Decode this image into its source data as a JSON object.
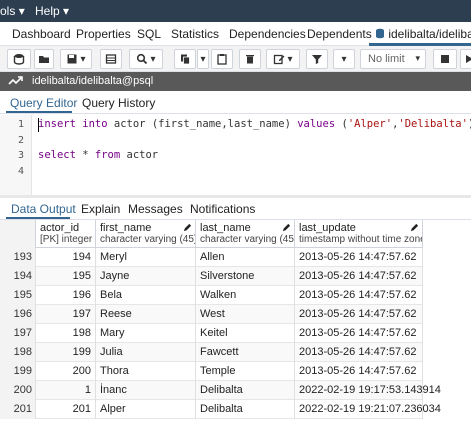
{
  "menubar": {
    "tools_label": "ols",
    "help_label": "Help"
  },
  "tabs": [
    "Dashboard",
    "Properties",
    "SQL",
    "Statistics",
    "Dependencies",
    "Dependents"
  ],
  "active_tab": {
    "label": "idelibalta/idelibalt"
  },
  "toolbar": {
    "limit_value": "No limit"
  },
  "connection": {
    "label": "idelibalta/idelibalta@psql"
  },
  "query_tabs": {
    "editor": "Query Editor",
    "history": "Query History"
  },
  "editor": {
    "line_numbers": [
      "1",
      "2",
      "3",
      "4"
    ],
    "line1": {
      "kw1": "insert",
      "kw2": "into",
      "rest1": " actor (first_name,last_name) ",
      "kw3": "values",
      "rest2": " (",
      "s1": "'Alper'",
      "comma": ",",
      "s2": "'Delibalta'",
      "rest3": ")"
    },
    "line3": {
      "kw1": "select",
      "rest1": " * ",
      "kw2": "from",
      "rest2": " actor"
    }
  },
  "result_tabs": [
    "Data Output",
    "Explain",
    "Messages",
    "Notifications"
  ],
  "columns": [
    {
      "name": "actor_id",
      "type": "[PK] integer"
    },
    {
      "name": "first_name",
      "type": "character varying (45)"
    },
    {
      "name": "last_name",
      "type": "character varying (45)"
    },
    {
      "name": "last_update",
      "type": "timestamp without time zone"
    }
  ],
  "rows": [
    {
      "n": "193",
      "id": "194",
      "first": "Meryl",
      "last": "Allen",
      "upd": "2013-05-26 14:47:57.62"
    },
    {
      "n": "194",
      "id": "195",
      "first": "Jayne",
      "last": "Silverstone",
      "upd": "2013-05-26 14:47:57.62"
    },
    {
      "n": "195",
      "id": "196",
      "first": "Bela",
      "last": "Walken",
      "upd": "2013-05-26 14:47:57.62"
    },
    {
      "n": "196",
      "id": "197",
      "first": "Reese",
      "last": "West",
      "upd": "2013-05-26 14:47:57.62"
    },
    {
      "n": "197",
      "id": "198",
      "first": "Mary",
      "last": "Keitel",
      "upd": "2013-05-26 14:47:57.62"
    },
    {
      "n": "198",
      "id": "199",
      "first": "Julia",
      "last": "Fawcett",
      "upd": "2013-05-26 14:47:57.62"
    },
    {
      "n": "199",
      "id": "200",
      "first": "Thora",
      "last": "Temple",
      "upd": "2013-05-26 14:47:57.62"
    },
    {
      "n": "200",
      "id": "1",
      "first": "İnanc",
      "last": "Delibalta",
      "upd": "2022-02-19 19:17:53.143914"
    },
    {
      "n": "201",
      "id": "201",
      "first": "Alper",
      "last": "Delibalta",
      "upd": "2022-02-19 19:21:07.236034"
    }
  ]
}
